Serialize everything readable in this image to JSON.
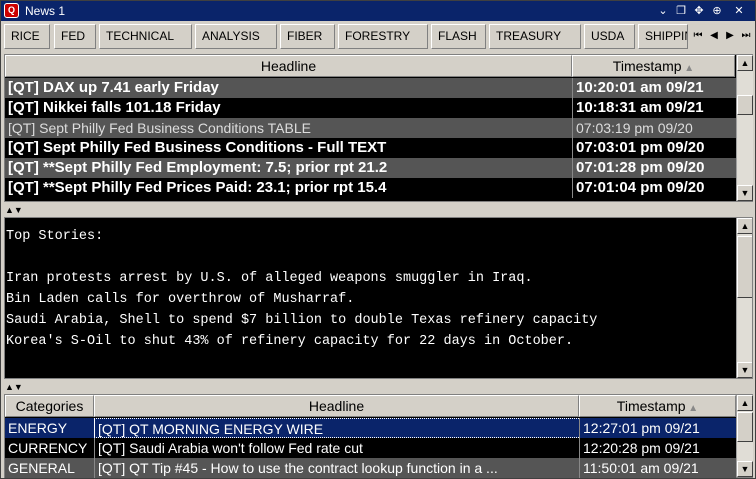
{
  "window": {
    "title": "News 1",
    "app_icon_text": "Q"
  },
  "tabs": [
    {
      "label": "RICE"
    },
    {
      "label": "FED"
    },
    {
      "label": "TECHNICAL"
    },
    {
      "label": "ANALYSIS"
    },
    {
      "label": "FIBER"
    },
    {
      "label": "FORESTRY"
    },
    {
      "label": "FLASH"
    },
    {
      "label": "TREASURY"
    },
    {
      "label": "USDA"
    },
    {
      "label": "SHIPPIN"
    }
  ],
  "headlines": {
    "columns": {
      "headline": "Headline",
      "timestamp": "Timestamp"
    },
    "rows": [
      {
        "headline": "[QT] DAX up 7.41 early Friday",
        "timestamp": "10:20:01 am 09/21",
        "style": "bold-gray"
      },
      {
        "headline": "[QT] Nikkei falls 101.18 Friday",
        "timestamp": "10:18:31 am 09/21",
        "style": "bold-black"
      },
      {
        "headline": "[QT] Sept Philly Fed Business Conditions TABLE",
        "timestamp": "07:03:19 pm 09/20",
        "style": "plain-gray"
      },
      {
        "headline": "[QT] Sept Philly Fed Business Conditions - Full TEXT",
        "timestamp": "07:03:01 pm 09/20",
        "style": "bold-black"
      },
      {
        "headline": "[QT] **Sept Philly Fed Employment: 7.5; prior rpt 21.2",
        "timestamp": "07:01:28 pm 09/20",
        "style": "bold-gray"
      },
      {
        "headline": "[QT] **Sept Philly Fed Prices Paid: 23.1; prior rpt 15.4",
        "timestamp": "07:01:04 pm 09/20",
        "style": "bold-black"
      }
    ]
  },
  "story": {
    "lines": [
      "Top Stories:",
      "",
      "Iran protests arrest by U.S. of alleged weapons smuggler in Iraq.",
      "Bin Laden calls for overthrow of Musharraf.",
      "Saudi Arabia, Shell to spend $7 billion to double Texas refinery capacity",
      "Korea's S-Oil to shut 43% of refinery capacity for 22 days in October."
    ]
  },
  "categorized": {
    "columns": {
      "category": "Categories",
      "headline": "Headline",
      "timestamp": "Timestamp"
    },
    "rows": [
      {
        "category": "ENERGY",
        "headline": "[QT] QT MORNING ENERGY WIRE",
        "timestamp": "12:27:01 pm 09/21",
        "style": "selected"
      },
      {
        "category": "CURRENCY",
        "headline": "[QT] Saudi Arabia won't follow Fed rate cut",
        "timestamp": "12:20:28 pm 09/21",
        "style": "plain-black"
      },
      {
        "category": "GENERAL",
        "headline": "[QT] QT Tip #45 - How to use the contract lookup function in a ...",
        "timestamp": "11:50:01 am 09/21",
        "style": "plain-gray"
      }
    ]
  }
}
